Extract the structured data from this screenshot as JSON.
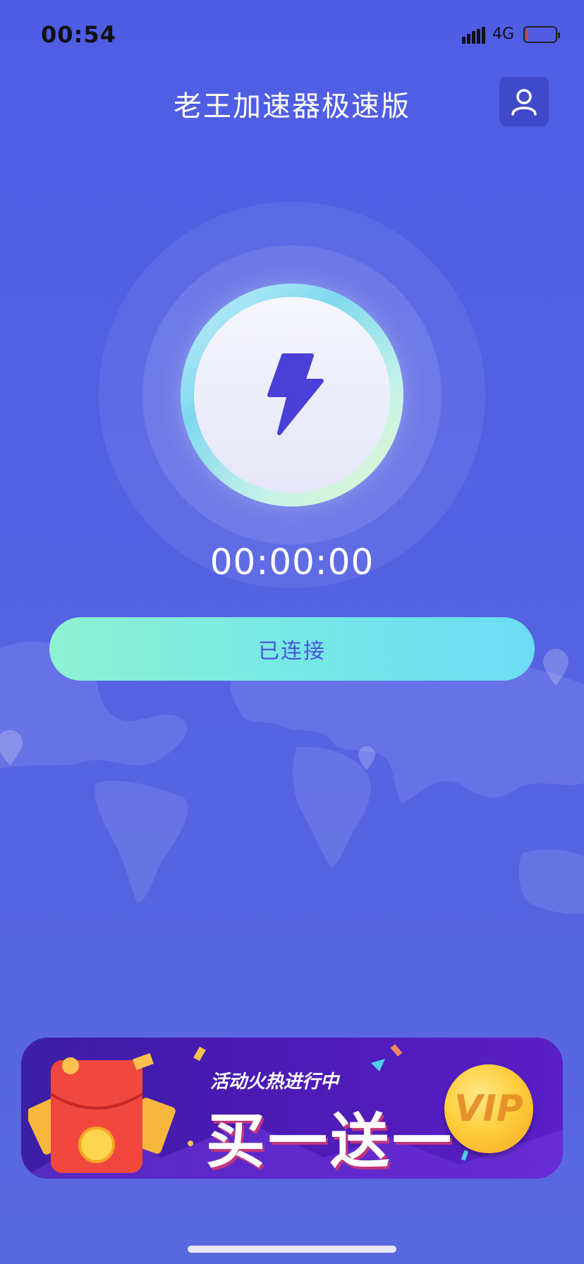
{
  "status_bar": {
    "time": "00:54",
    "network": "4G"
  },
  "header": {
    "title": "老王加速器极速版",
    "profile_icon": "user-icon"
  },
  "main": {
    "power_icon": "lightning-icon",
    "timer": "00:00:00",
    "connect_button_label": "已连接"
  },
  "banner": {
    "subtitle": "活动火热进行中",
    "headline": "买一送一",
    "badge": "VIP"
  },
  "colors": {
    "background": "#4f5de4",
    "button_gradient_start": "#8ef2d2",
    "button_gradient_end": "#6cdcf5",
    "button_text": "#4a56d6",
    "bolt": "#4a3fd6"
  }
}
